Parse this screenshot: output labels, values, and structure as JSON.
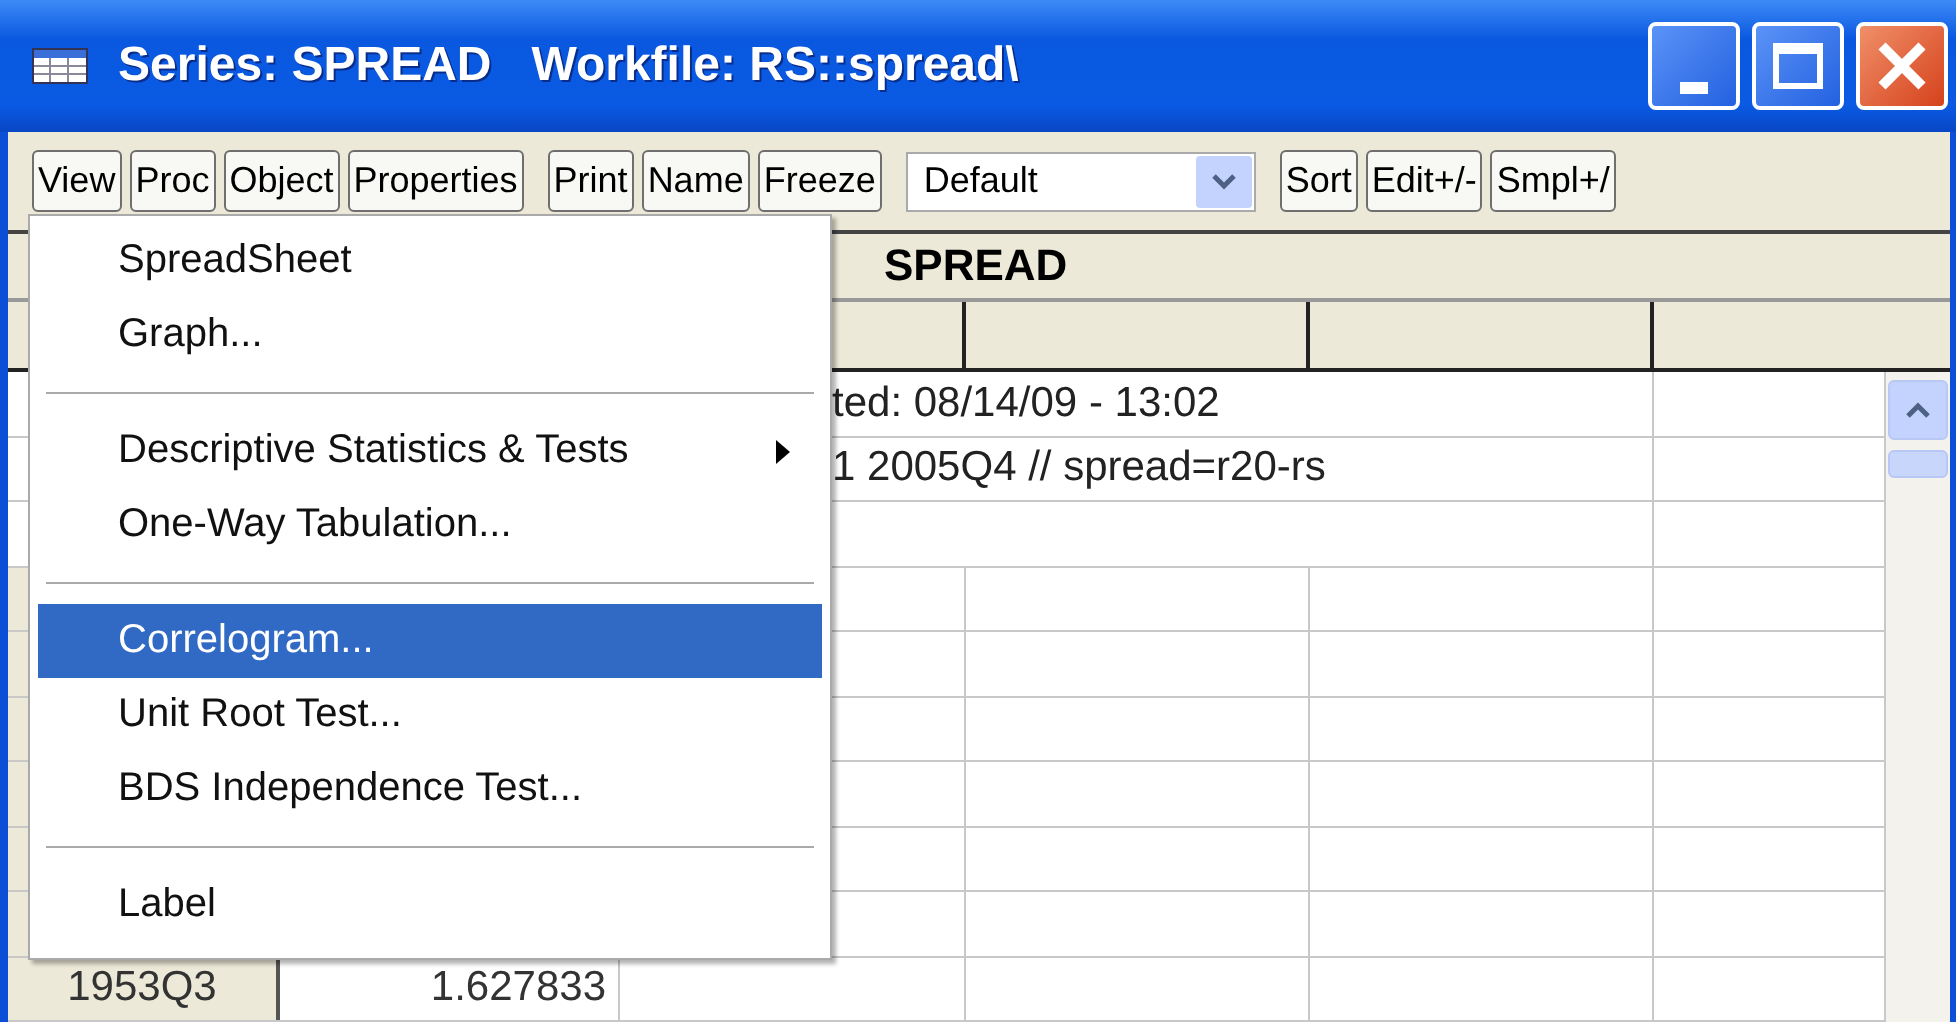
{
  "window": {
    "title": "Series: SPREAD   Workfile: RS::spread\\"
  },
  "toolbar": [
    {
      "kind": "buttons",
      "labels": [
        "View",
        "Proc",
        "Object",
        "Properties"
      ]
    },
    {
      "kind": "buttons",
      "labels": [
        "Print",
        "Name",
        "Freeze"
      ]
    },
    {
      "kind": "dropdown",
      "value": "Default"
    },
    {
      "kind": "buttons",
      "labels": [
        "Sort",
        "Edit+/-",
        "Smpl+/"
      ]
    }
  ],
  "table": {
    "title": "SPREAD",
    "comments": [
      "ted: 08/14/09 - 13:02",
      "1 2005Q4 // spread=r20-rs"
    ],
    "rows": [
      {
        "obs": "1953Q3",
        "value": "1.627833"
      }
    ]
  },
  "menu": [
    {
      "kind": "item",
      "label": "SpreadSheet",
      "selected": false,
      "submenu": false
    },
    {
      "kind": "item",
      "label": "Graph...",
      "selected": false,
      "submenu": false
    },
    {
      "kind": "separator"
    },
    {
      "kind": "item",
      "label": "Descriptive Statistics & Tests",
      "selected": false,
      "submenu": true
    },
    {
      "kind": "item",
      "label": "One-Way Tabulation...",
      "selected": false,
      "submenu": false
    },
    {
      "kind": "separator"
    },
    {
      "kind": "item",
      "label": "Correlogram...",
      "selected": true,
      "submenu": false
    },
    {
      "kind": "item",
      "label": "Unit Root Test...",
      "selected": false,
      "submenu": false
    },
    {
      "kind": "item",
      "label": "BDS Independence Test...",
      "selected": false,
      "submenu": false
    },
    {
      "kind": "separator"
    },
    {
      "kind": "item",
      "label": "Label",
      "selected": false,
      "submenu": false
    }
  ]
}
